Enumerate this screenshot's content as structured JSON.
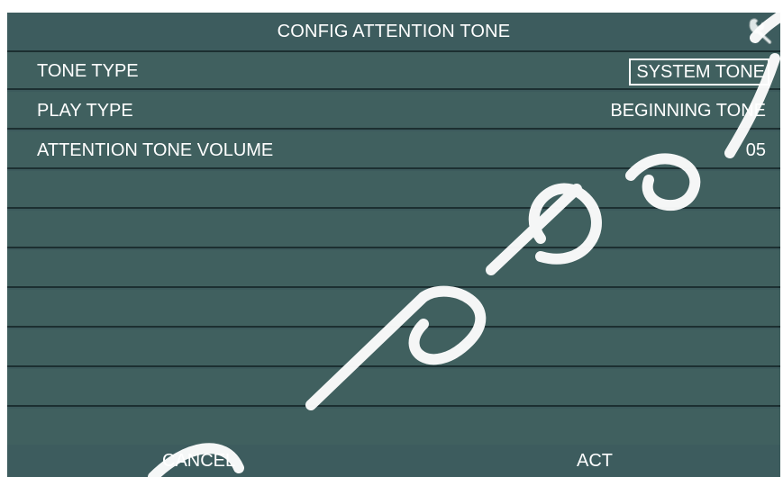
{
  "header": {
    "title": "CONFIG ATTENTION TONE",
    "icon": "wrench-icon"
  },
  "settings": [
    {
      "label": "TONE TYPE",
      "value": "SYSTEM TONE",
      "selected": true
    },
    {
      "label": "PLAY TYPE",
      "value": "BEGINNING TONE",
      "selected": false
    },
    {
      "label": "ATTENTION TONE VOLUME",
      "value": "05",
      "selected": false
    }
  ],
  "footer": {
    "cancel_label": "CANCEL",
    "act_label": "ACT"
  },
  "colors": {
    "background": "#3c5a5c",
    "row_divider": "#1c2f31",
    "text": "#ffffff"
  }
}
